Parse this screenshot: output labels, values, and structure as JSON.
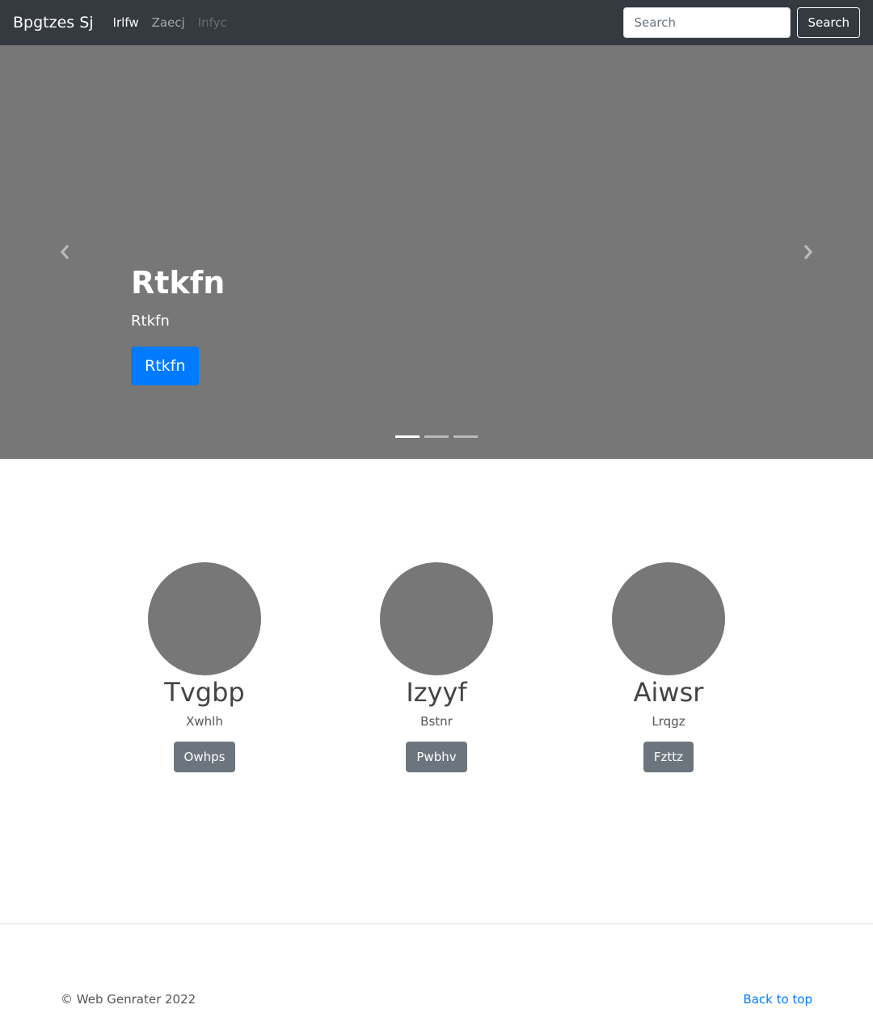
{
  "navbar": {
    "brand": "Bpgtzes Sj",
    "links": [
      {
        "label": "Irlfw",
        "state": "active"
      },
      {
        "label": "Zaecj",
        "state": "normal"
      },
      {
        "label": "Infyc",
        "state": "disabled"
      }
    ],
    "search_placeholder": "Search",
    "search_button": "Search"
  },
  "carousel": {
    "heading": "Rtkfn",
    "text": "Rtkfn",
    "button": "Rtkfn",
    "indicators_count": 3,
    "active_indicator": 0,
    "prev_icon": "chevron-left-icon",
    "next_icon": "chevron-right-icon"
  },
  "columns": [
    {
      "heading": "Tvgbp",
      "text": "Xwhlh",
      "button": "Owhps"
    },
    {
      "heading": "Izyyf",
      "text": "Bstnr",
      "button": "Pwbhv"
    },
    {
      "heading": "Aiwsr",
      "text": "Lrqgz",
      "button": "Fzttz"
    }
  ],
  "footer": {
    "copyright": "© Web Genrater 2022",
    "back_to_top": "Back to top"
  },
  "colors": {
    "navbar_bg": "#343a40",
    "carousel_bg": "#777777",
    "primary": "#007bff",
    "secondary": "#6c757d"
  }
}
